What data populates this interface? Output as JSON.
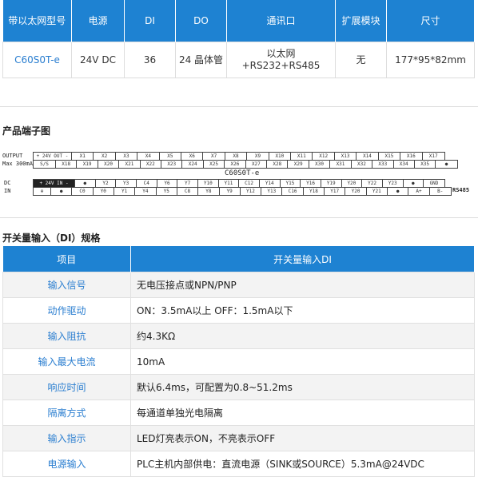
{
  "spec_table": {
    "headers": [
      "带以太网型号",
      "电源",
      "DI",
      "DO",
      "通讯口",
      "扩展模块",
      "尺寸"
    ],
    "row": [
      "C60S0T-e",
      "24V DC",
      "36",
      "24 晶体管",
      "以太网+RS232+RS485",
      "无",
      "177*95*82mm"
    ]
  },
  "terminal_section": {
    "title": "产品端子图",
    "model": "C60S0T-e",
    "left_labels": [
      "OUTPUT",
      "Max 300mA",
      "DC",
      "IN"
    ],
    "rs485_label": "RS485",
    "row1": [
      "+ 24V OUT -",
      "X1",
      "X2",
      "X3",
      "X4",
      "X5",
      "X6",
      "X7",
      "X8",
      "X9",
      "X10",
      "X11",
      "X12",
      "X13",
      "X14",
      "X15",
      "X16",
      "X17"
    ],
    "row2": [
      "S/S",
      "X18",
      "X19",
      "X20",
      "X21",
      "X22",
      "X23",
      "X24",
      "X25",
      "X26",
      "X27",
      "X28",
      "X29",
      "X30",
      "X31",
      "X32",
      "X33",
      "X34",
      "X35",
      "●"
    ],
    "row3": [
      "+ 24V IN -",
      "●",
      "Y2",
      "Y3",
      "C4",
      "Y6",
      "Y7",
      "Y10",
      "Y11",
      "C12",
      "Y14",
      "Y15",
      "Y16",
      "Y19",
      "Y20",
      "Y22",
      "Y23",
      "●",
      "GND"
    ],
    "row4": [
      "⊕",
      "●",
      "C0",
      "Y0",
      "Y1",
      "Y4",
      "Y5",
      "C8",
      "Y8",
      "Y9",
      "Y12",
      "Y13",
      "C16",
      "Y18",
      "Y17",
      "Y20",
      "Y21",
      "●",
      "A+",
      "B-"
    ]
  },
  "di_section": {
    "title": "开关量输入（DI）规格",
    "headers": [
      "项目",
      "开关量输入DI"
    ],
    "rows": [
      {
        "item": "输入信号",
        "value": "无电压接点或NPN/PNP"
      },
      {
        "item": "动作驱动",
        "value": "ON：3.5mA以上  OFF：1.5mA以下"
      },
      {
        "item": "输入阻抗",
        "value": "约4.3KΩ"
      },
      {
        "item": "输入最大电流",
        "value": "10mA"
      },
      {
        "item": "响应时间",
        "value": "默认6.4ms，可配置为0.8~51.2ms"
      },
      {
        "item": "隔离方式",
        "value": "每通道单独光电隔离"
      },
      {
        "item": "输入指示",
        "value": "LED灯亮表示ON，不亮表示OFF"
      },
      {
        "item": "电源输入",
        "value": "PLC主机内部供电：直流电源（SINK或SOURCE）5.3mA@24VDC"
      }
    ]
  }
}
